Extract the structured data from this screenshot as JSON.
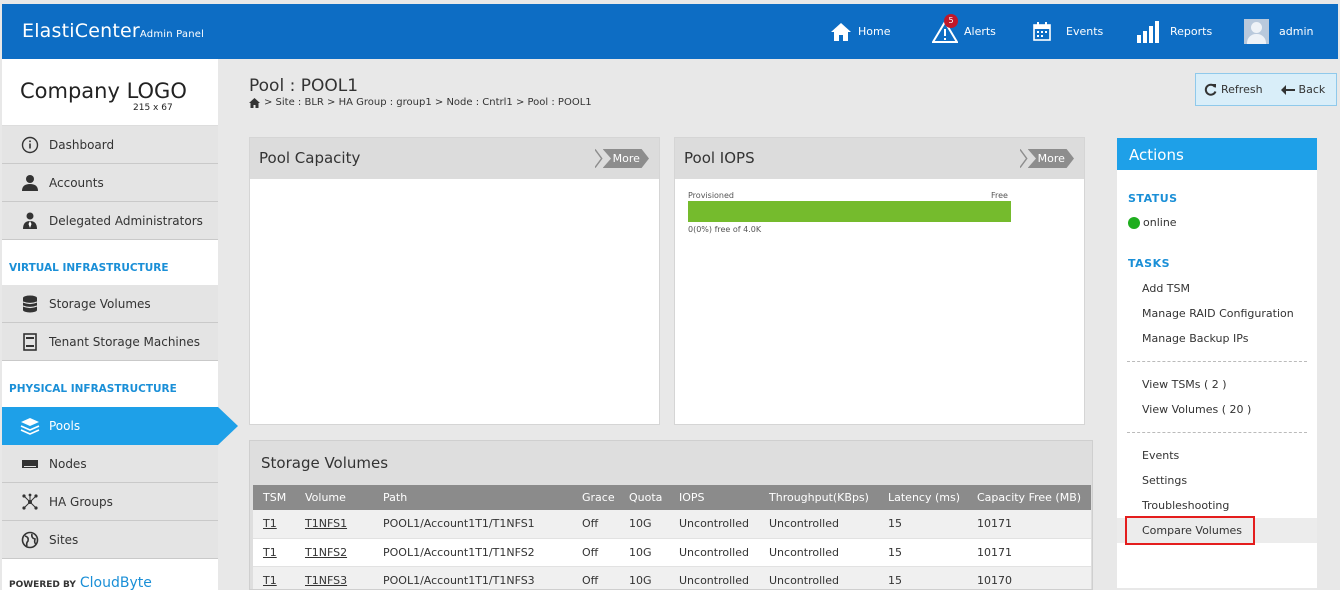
{
  "app": {
    "brand": "ElastiCenter",
    "brand_sub": "Admin Panel"
  },
  "topnav": {
    "home": "Home",
    "alerts": "Alerts",
    "alerts_count": "5",
    "events": "Events",
    "reports": "Reports",
    "user": "admin"
  },
  "sidebar": {
    "logo_text": "Company LOGO",
    "logo_size": "215 x 67",
    "top_items": [
      {
        "label": "Dashboard",
        "icon": "info-icon"
      },
      {
        "label": "Accounts",
        "icon": "user-icon"
      },
      {
        "label": "Delegated Administrators",
        "icon": "admin-icon"
      }
    ],
    "virtual_heading": "VIRTUAL INFRASTRUCTURE",
    "virtual_items": [
      {
        "label": "Storage Volumes",
        "icon": "database-icon"
      },
      {
        "label": "Tenant Storage Machines",
        "icon": "server-icon"
      }
    ],
    "physical_heading": "PHYSICAL INFRASTRUCTURE",
    "physical_items": [
      {
        "label": "Pools",
        "icon": "layers-icon",
        "active": true
      },
      {
        "label": "Nodes",
        "icon": "node-icon"
      },
      {
        "label": "HA Groups",
        "icon": "network-icon"
      },
      {
        "label": "Sites",
        "icon": "globe-icon"
      }
    ],
    "powered_by": "POWERED BY",
    "powered_brand": "CloudByte"
  },
  "header": {
    "title": "Pool : POOL1",
    "breadcrumb": "> Site : BLR > HA Group : group1 > Node : Cntrl1 > Pool : POOL1",
    "refresh": "Refresh",
    "back": "Back"
  },
  "capacity_panel": {
    "title": "Pool Capacity",
    "more": "More"
  },
  "iops_panel": {
    "title": "Pool IOPS",
    "more": "More",
    "provisioned_label": "Provisioned",
    "free_label": "Free",
    "note": "0(0%) free of 4.0K",
    "provisioned_fraction": 1.0
  },
  "volumes": {
    "title": "Storage Volumes",
    "columns": [
      "TSM",
      "Volume",
      "Path",
      "Grace",
      "Quota",
      "IOPS",
      "Throughput(KBps)",
      "Latency (ms)",
      "Capacity Free (MB)"
    ],
    "rows": [
      [
        "T1",
        "T1NFS1",
        "POOL1/Account1T1/T1NFS1",
        "Off",
        "10G",
        "Uncontrolled",
        "Uncontrolled",
        "15",
        "10171"
      ],
      [
        "T1",
        "T1NFS2",
        "POOL1/Account1T1/T1NFS2",
        "Off",
        "10G",
        "Uncontrolled",
        "Uncontrolled",
        "15",
        "10171"
      ],
      [
        "T1",
        "T1NFS3",
        "POOL1/Account1T1/T1NFS3",
        "Off",
        "10G",
        "Uncontrolled",
        "Uncontrolled",
        "15",
        "10170"
      ]
    ]
  },
  "actions": {
    "title": "Actions",
    "status_heading": "STATUS",
    "status_value": "online",
    "status_color": "#1fae1f",
    "tasks_heading": "TASKS",
    "tasks": [
      "Add TSM",
      "Manage RAID Configuration",
      "Manage Backup IPs"
    ],
    "views": [
      "View TSMs ( 2 )",
      "View Volumes ( 20 )"
    ],
    "misc": [
      "Events",
      "Settings",
      "Troubleshooting",
      "Compare Volumes"
    ]
  },
  "colors": {
    "topbar": "#0d6dc4",
    "accent": "#1ea0e8",
    "iops_bar": "#75bb2d",
    "highlight_border": "#e41d1d"
  }
}
